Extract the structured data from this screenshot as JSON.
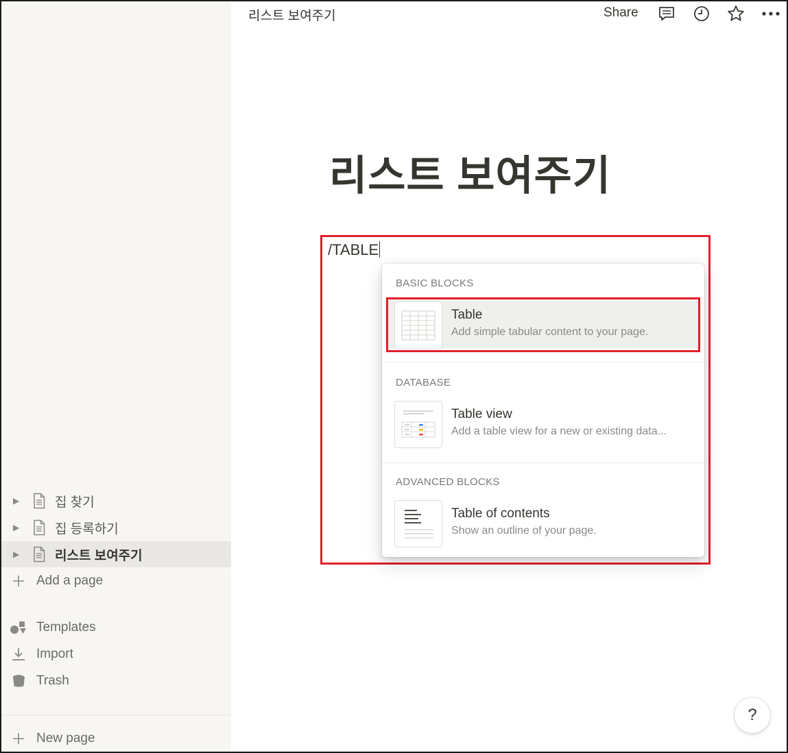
{
  "topbar": {
    "breadcrumb": "리스트 보여주기",
    "share_label": "Share",
    "icons": [
      "comment-icon",
      "clock-icon",
      "star-icon",
      "more-icon"
    ]
  },
  "sidebar": {
    "pages": [
      {
        "label": "집 찾기",
        "icon": "document-icon",
        "active": false
      },
      {
        "label": "집 등록하기",
        "icon": "document-icon",
        "active": false
      },
      {
        "label": "리스트 보여주기",
        "icon": "document-icon",
        "active": true
      }
    ],
    "add_page_label": "Add a page",
    "actions": [
      {
        "label": "Templates",
        "icon": "templates-icon"
      },
      {
        "label": "Import",
        "icon": "import-icon"
      },
      {
        "label": "Trash",
        "icon": "trash-icon"
      }
    ],
    "new_page_label": "New page"
  },
  "page": {
    "title": "리스트 보여주기",
    "input_text": "/TABLE"
  },
  "menu": {
    "sections": [
      {
        "header": "BASIC BLOCKS",
        "items": [
          {
            "title": "Table",
            "description": "Add simple tabular content to your page.",
            "icon": "table-icon",
            "highlighted": true
          }
        ]
      },
      {
        "header": "DATABASE",
        "items": [
          {
            "title": "Table view",
            "description": "Add a table view for a new or existing data...",
            "icon": "table-view-icon",
            "highlighted": false
          }
        ]
      },
      {
        "header": "ADVANCED BLOCKS",
        "items": [
          {
            "title": "Table of contents",
            "description": "Show an outline of your page.",
            "icon": "table-of-contents-icon",
            "highlighted": false
          }
        ]
      }
    ]
  },
  "help_label": "?",
  "colors": {
    "sidebar_bg": "#f7f6f3",
    "annotation_red": "#e0202c",
    "text": "#37352f",
    "muted_text": "#8a8985"
  }
}
